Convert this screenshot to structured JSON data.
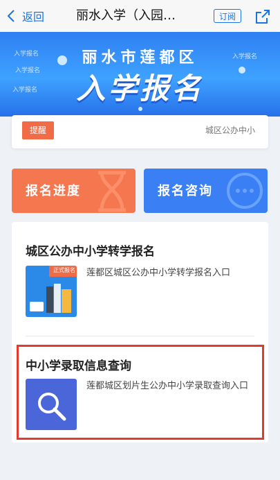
{
  "header": {
    "back_label": "返回",
    "title": "丽水入学（入园…",
    "subscribe_label": "订阅"
  },
  "banner": {
    "line1": "丽水市莲都区",
    "line2": "入学报名",
    "tags": [
      "入学报名",
      "入学报名",
      "入学报名",
      "入学报名"
    ]
  },
  "notice": {
    "badge": "提醒",
    "text": "城区公办中小"
  },
  "tiles": [
    {
      "label": "报名进度"
    },
    {
      "label": "报名咨询"
    }
  ],
  "section1": {
    "title": "城区公办中小学转学报名",
    "badge": "正式报名",
    "desc": "莲都区城区公办中小学转学报名入口"
  },
  "section2": {
    "title": "中小学录取信息查询",
    "desc": "莲都城区划片生公办中小学录取查询入口"
  }
}
